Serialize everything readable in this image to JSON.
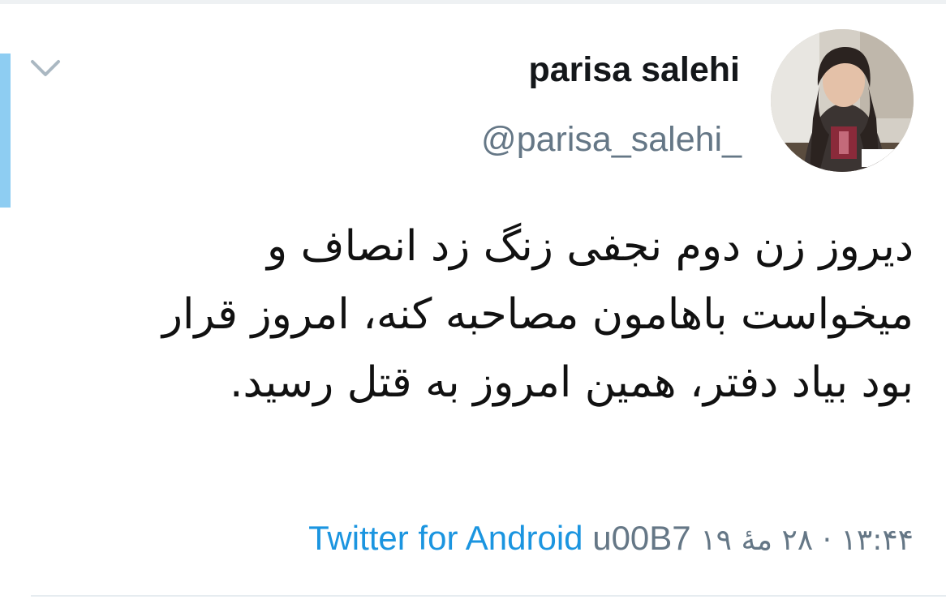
{
  "tweet": {
    "display_name": "parisa salehi",
    "handle": "@parisa_salehi_",
    "text": "دیروز زن دوم نجفی زنگ زد انصاف و میخواست باهامون مصاحبه کنه، امروز قرار بود بیاد دفتر، همین امروز به قتل رسید.",
    "timestamp": "۱۳:۴۴ · ۲۸ مهٔ ۱۹",
    "separator": "u00B7",
    "client": "Twitter for Android"
  },
  "icons": {
    "menu": "chevron-down-icon",
    "avatar": "avatar"
  },
  "colors": {
    "accent_bar": "#8ecdf2",
    "link": "#1b95e0",
    "secondary_text": "#657786",
    "primary_text": "#14171a"
  }
}
